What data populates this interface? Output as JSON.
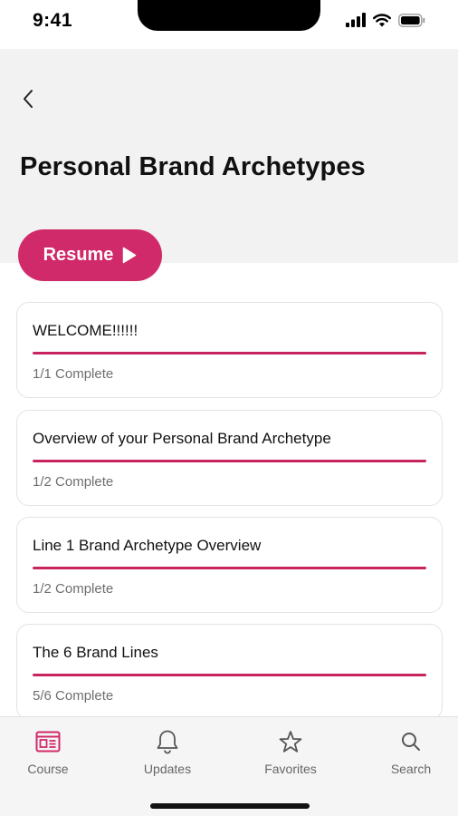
{
  "status_bar": {
    "time": "9:41"
  },
  "header": {
    "title": "Personal Brand Archetypes",
    "back_icon": "chevron-left-icon"
  },
  "resume_button": {
    "label": "Resume",
    "icon": "play-icon",
    "color": "#d12a6a"
  },
  "accent_color": "#c8245f",
  "lessons": [
    {
      "title": "WELCOME!!!!!!",
      "progress": "1/1 Complete",
      "completed": 1,
      "total": 1
    },
    {
      "title": "Overview of your Personal Brand Archetype",
      "progress": "1/2 Complete",
      "completed": 1,
      "total": 2
    },
    {
      "title": "Line 1 Brand Archetype Overview",
      "progress": "1/2 Complete",
      "completed": 1,
      "total": 2
    },
    {
      "title": "The 6 Brand Lines",
      "progress": "5/6 Complete",
      "completed": 5,
      "total": 6
    }
  ],
  "tab_bar": {
    "items": [
      {
        "label": "Course",
        "icon": "course-icon",
        "active": true,
        "active_color": "#d12a6a"
      },
      {
        "label": "Updates",
        "icon": "bell-icon",
        "active": false
      },
      {
        "label": "Favorites",
        "icon": "star-icon",
        "active": false
      },
      {
        "label": "Search",
        "icon": "search-icon",
        "active": false
      }
    ]
  }
}
